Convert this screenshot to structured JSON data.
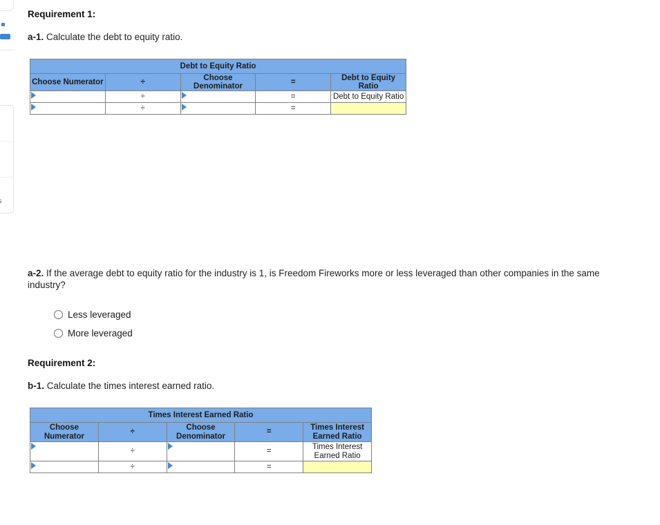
{
  "left_gutter": {
    "truncated_list_text": "es"
  },
  "requirement1": {
    "heading": "Requirement 1:",
    "a1": {
      "label": "a-1.",
      "text": " Calculate the debt to equity ratio."
    },
    "a2": {
      "label": "a-2.",
      "text": " If the average debt to equity ratio for the industry is 1, is Freedom Fireworks more or less leveraged than other companies in the same industry?",
      "options": [
        {
          "label": "Less leveraged",
          "selected": false
        },
        {
          "label": "More leveraged",
          "selected": false
        }
      ]
    }
  },
  "requirement2": {
    "heading": "Requirement 2:",
    "b1": {
      "label": "b-1.",
      "text": " Calculate the times interest earned ratio."
    }
  },
  "debt_equity_table": {
    "title": "Debt to Equity Ratio",
    "headers": {
      "numerator": "Choose Numerator",
      "divide": "÷",
      "denominator": "Choose Denominator",
      "equals": "=",
      "result": "Debt to Equity Ratio"
    },
    "rows": [
      {
        "numerator": "",
        "divide": "÷",
        "denominator": "",
        "equals": "=",
        "result": "Debt to Equity Ratio",
        "result_is_input": false
      },
      {
        "numerator": "",
        "divide": "÷",
        "denominator": "",
        "equals": "=",
        "result": "",
        "result_is_input": true
      }
    ]
  },
  "times_interest_table": {
    "title": "Times Interest Earned Ratio",
    "headers": {
      "numerator": "Choose Numerator",
      "divide": "÷",
      "denominator": "Choose Denominator",
      "equals": "=",
      "result": "Times Interest Earned Ratio"
    },
    "rows": [
      {
        "numerator": "",
        "divide": "÷",
        "denominator": "",
        "equals": "=",
        "result": "Times Interest Earned Ratio",
        "result_is_input": false
      },
      {
        "numerator": "",
        "divide": "÷",
        "denominator": "",
        "equals": "=",
        "result": "",
        "result_is_input": true
      }
    ]
  },
  "colors": {
    "header_blue": "#79ace8",
    "input_yellow": "#ffffb4",
    "border_gray": "#808080",
    "arrow_blue": "#4a86c8"
  }
}
